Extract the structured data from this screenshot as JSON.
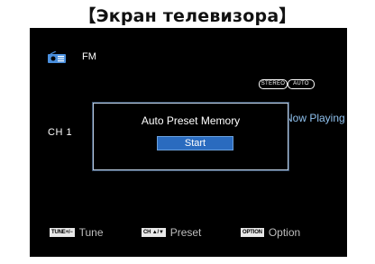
{
  "caption": "【Экран телевизора】",
  "tv": {
    "radio_icon": "radio-icon",
    "band": "FM",
    "indicators": {
      "stereo": "STEREO",
      "auto": "AUTO"
    },
    "now_playing": "Now Playing",
    "channel": "CH 1"
  },
  "dialog": {
    "title": "Auto Preset Memory",
    "start_label": "Start"
  },
  "hints": {
    "tune": {
      "key": "TUNE+/−",
      "label": "Tune"
    },
    "preset": {
      "key": "CH ▲/▼",
      "label": "Preset"
    },
    "option": {
      "key": "OPTION",
      "label": "Option"
    }
  },
  "colors": {
    "screen_background": "#000000",
    "now_playing_text": "#8fc1ee",
    "button_fill": "#2a6bbf",
    "dialog_border": "#b9cbe0"
  }
}
